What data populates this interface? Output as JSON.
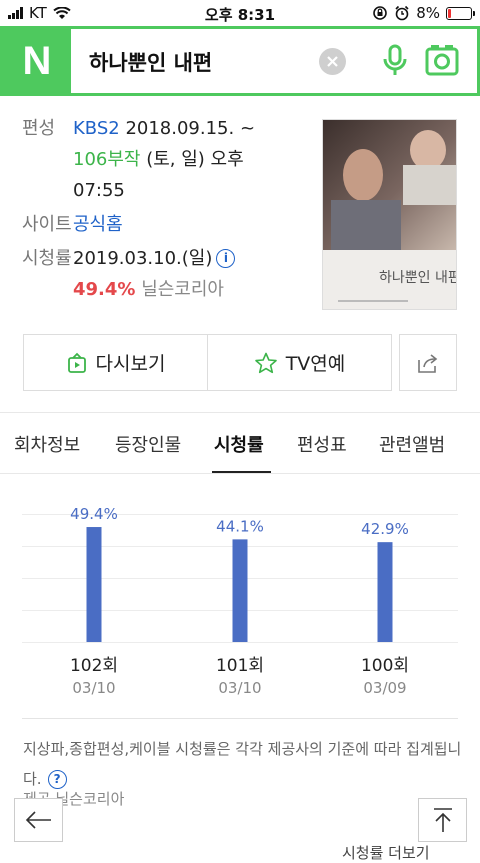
{
  "status_bar": {
    "carrier": "KT",
    "time": "오후 8:31",
    "battery": "8%"
  },
  "search": {
    "query": "하나뿐인 내편",
    "logo": "N"
  },
  "program": {
    "broadcast_label": "편성",
    "channel": "KBS2",
    "date_range": "2018.09.15. ~",
    "episodes": "106부작",
    "schedule": "(토, 일) 오후",
    "time": "07:55",
    "site_label": "사이트",
    "site_link": "공식홈",
    "rating_label": "시청률",
    "rating_date": "2019.03.10.(일)",
    "rating_value": "49.4%",
    "rating_source": "닐슨코리아"
  },
  "poster": {
    "title_text": "하나뿐인 내편"
  },
  "actions": {
    "replay_label": "다시보기",
    "tv_label": "TV연예"
  },
  "tabs": [
    {
      "label": "회차정보",
      "active": false
    },
    {
      "label": "등장인물",
      "active": false
    },
    {
      "label": "시청률",
      "active": true
    },
    {
      "label": "편성표",
      "active": false
    },
    {
      "label": "관련앨범",
      "active": false
    }
  ],
  "chart_data": {
    "type": "bar",
    "categories": [
      "102회",
      "101회",
      "100회"
    ],
    "dates": [
      "03/10",
      "03/10",
      "03/09"
    ],
    "values": [
      49.4,
      44.1,
      42.9
    ],
    "value_labels": [
      "49.4%",
      "44.1%",
      "42.9%"
    ],
    "ylim": [
      0,
      55
    ],
    "grid": true,
    "bar_color": "#4a6dc4",
    "label_color": "#4a6dc4"
  },
  "footnote": {
    "text": "지상파,종합편성,케이블 시청률은 각각 제공사의 기준에 따라 집계됩니다.",
    "source": "제공 닐슨코리아"
  },
  "more_link": "시청률 더보기",
  "colors": {
    "brand": "#4ec95e",
    "link": "#1f62c8",
    "episodes": "#3cb44a",
    "rating": "#e4484b"
  }
}
